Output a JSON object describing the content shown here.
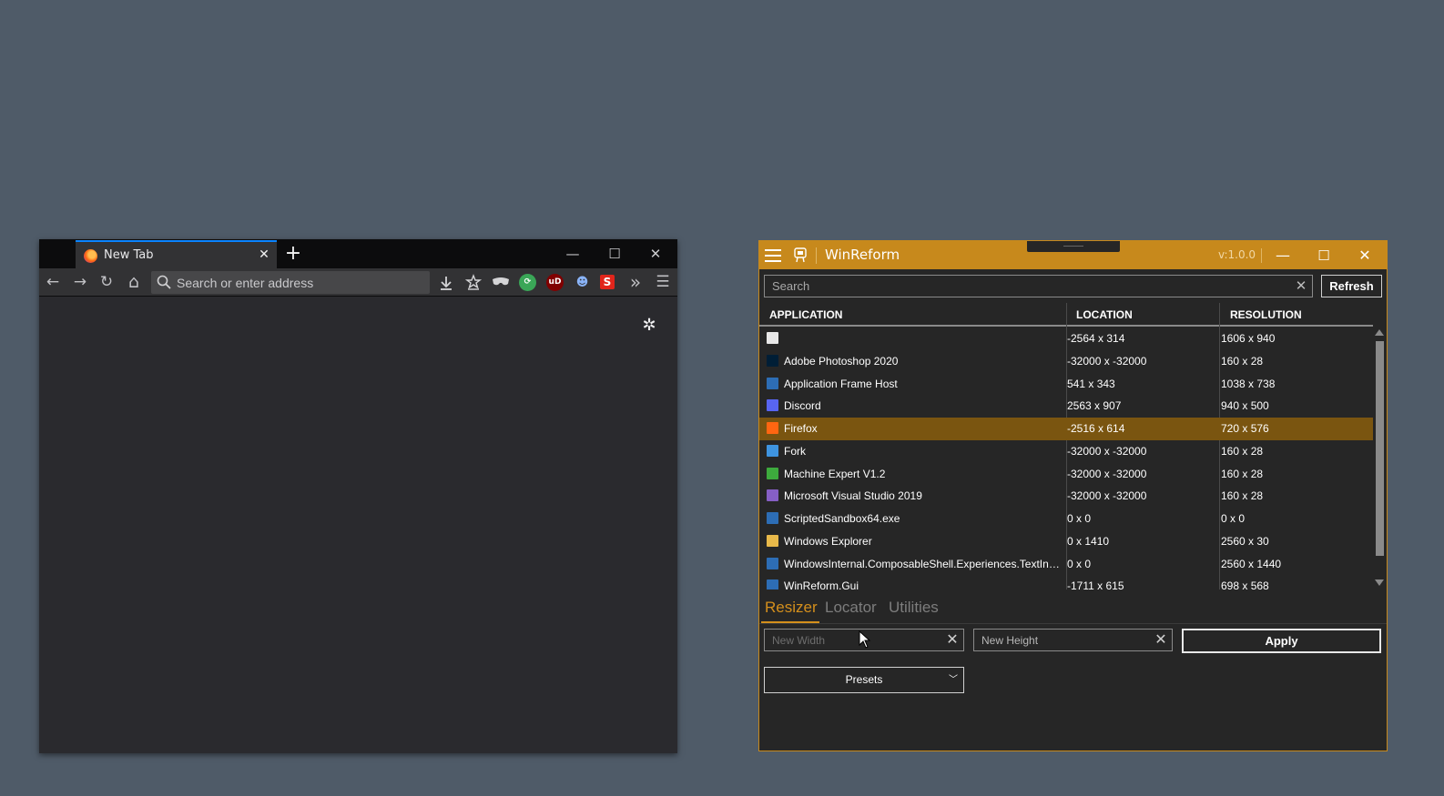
{
  "firefox": {
    "tab_title": "New Tab",
    "tab_close": "✕",
    "new_tab": "+",
    "window_controls": {
      "minimize": "—",
      "maximize": "☐",
      "close": "✕"
    },
    "nav": {
      "back": "←",
      "forward": "→",
      "reload": "↻",
      "home": "⌂"
    },
    "url_placeholder": "Search or enter address",
    "toolbar_icons": [
      "download-icon",
      "bookmarks-icon",
      "mask-icon",
      "sync-icon",
      "ublock-icon",
      "ghost-icon",
      "s-extension-icon",
      "overflow-icon",
      "menu-icon"
    ],
    "ext_labels": {
      "ublock": "uD",
      "s": "S"
    },
    "overflow": "»",
    "menu": "☰",
    "gear": "✲"
  },
  "winreform": {
    "title": "WinReform",
    "version": "v:1.0.0",
    "window_controls": {
      "minimize": "—",
      "maximize": "☐",
      "close": "✕"
    },
    "search_placeholder": "Search",
    "search_clear": "✕",
    "refresh_label": "Refresh",
    "columns": [
      "APPLICATION",
      "LOCATION",
      "RESOLUTION"
    ],
    "rows": [
      {
        "app": "",
        "location": "-2564 x 314",
        "resolution": "1606 x 940",
        "icon": "window-icon",
        "color": "#e8e8e8"
      },
      {
        "app": "Adobe Photoshop 2020",
        "location": "-32000 x -32000",
        "resolution": "160 x 28",
        "icon": "photoshop-icon",
        "color": "#001e36"
      },
      {
        "app": "Application Frame Host",
        "location": "541 x 343",
        "resolution": "1038 x 738",
        "icon": "app-window-icon",
        "color": "#2d6db5"
      },
      {
        "app": "Discord",
        "location": "2563 x 907",
        "resolution": "940 x 500",
        "icon": "discord-icon",
        "color": "#5865f2"
      },
      {
        "app": "Firefox",
        "location": "-2516 x 614",
        "resolution": "720 x 576",
        "icon": "firefox-icon",
        "color": "#ff6611"
      },
      {
        "app": "Fork",
        "location": "-32000 x -32000",
        "resolution": "160 x 28",
        "icon": "fork-icon",
        "color": "#3e94e0"
      },
      {
        "app": "Machine Expert V1.2",
        "location": "-32000 x -32000",
        "resolution": "160 x 28",
        "icon": "machine-expert-icon",
        "color": "#3daa3d"
      },
      {
        "app": "Microsoft Visual Studio 2019",
        "location": "-32000 x -32000",
        "resolution": "160 x 28",
        "icon": "visual-studio-icon",
        "color": "#865fc5"
      },
      {
        "app": "ScriptedSandbox64.exe",
        "location": "0 x 0",
        "resolution": "0 x 0",
        "icon": "app-window-icon",
        "color": "#2d6db5"
      },
      {
        "app": "Windows Explorer",
        "location": "0 x 1410",
        "resolution": "2560 x 30",
        "icon": "folder-icon",
        "color": "#e8b94a"
      },
      {
        "app": "WindowsInternal.ComposableShell.Experiences.TextInput.InputApp",
        "location": "0 x 0",
        "resolution": "2560 x 1440",
        "icon": "app-window-icon",
        "color": "#2d6db5"
      },
      {
        "app": "WinReform.Gui",
        "location": "-1711 x 615",
        "resolution": "698 x 568",
        "icon": "app-window-icon",
        "color": "#2d6db5"
      }
    ],
    "selected_row": "Firefox",
    "tabs": [
      "Resizer",
      "Locator",
      "Utilities"
    ],
    "active_tab": "Resizer",
    "width_placeholder": "New Width",
    "height_placeholder": "New Height",
    "field_clear": "✕",
    "apply_label": "Apply",
    "presets_label": "Presets",
    "presets_chevron": "﹀",
    "accent_color": "#c7891c",
    "selected_color": "#7a5510"
  }
}
